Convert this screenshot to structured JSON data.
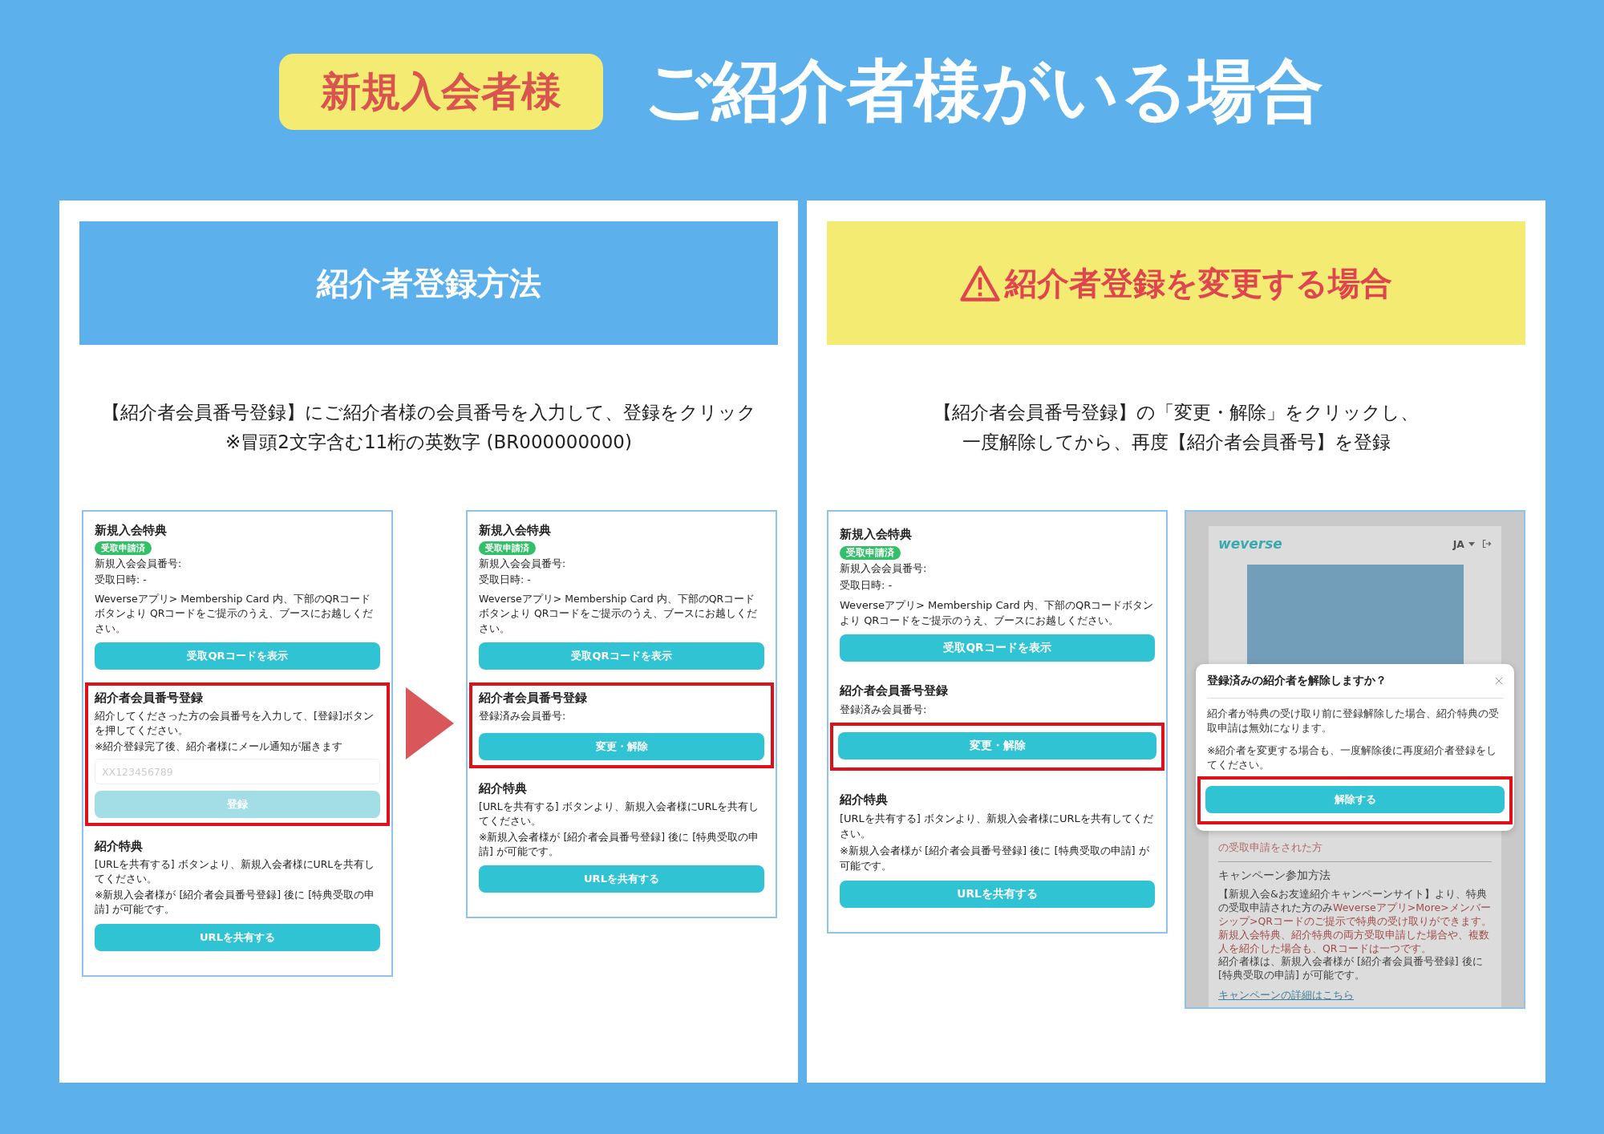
{
  "header": {
    "badge": "新規入会者様",
    "title": "ご紹介者様がいる場合"
  },
  "panels": [
    {
      "kind": "method",
      "heading": "紹介者登録方法",
      "arrow": true,
      "description": [
        "【紹介者会員番号登録】にご紹介者様の会員番号を入力して、登録をクリック",
        "※冒頭2文字含む11桁の英数字 (BR000000000)"
      ],
      "screens": [
        {
          "kind": "form",
          "benefit": {
            "title": "新規入会特典",
            "badge": "受取申請済",
            "member_no": "新規入会会員番号:",
            "date": "受取日時: -",
            "note": "Weverseアプリ> Membership Card 内、下部のQRコードボタンより QRコードをご提示のうえ、ブースにお越しください。",
            "button": "受取QRコードを表示"
          },
          "referral": {
            "title": "紹介者会員番号登録",
            "highlight": true,
            "text": "紹介してくださった方の会員番号を入力して、[登録]ボタンを押してください。",
            "note": "※紹介登録完了後、紹介者様にメール通知が届きます",
            "placeholder": "XX123456789",
            "button": "登録",
            "button_disabled": true,
            "button_highlight": false
          },
          "reward": {
            "title": "紹介特典",
            "text": "[URLを共有する] ボタンより、新規入会者様にURLを共有してください。",
            "note": "※新規入会者様が [紹介者会員番号登録] 後に [特典受取の申請] が可能です。",
            "button": "URLを共有する"
          }
        },
        {
          "kind": "form",
          "benefit": {
            "title": "新規入会特典",
            "badge": "受取申請済",
            "member_no": "新規入会会員番号:",
            "date": "受取日時: -",
            "note": "Weverseアプリ> Membership Card 内、下部のQRコードボタンより QRコードをご提示のうえ、ブースにお越しください。",
            "button": "受取QRコードを表示"
          },
          "referral": {
            "title": "紹介者会員番号登録",
            "highlight": true,
            "registered": "登録済み会員番号:",
            "button": "変更・解除",
            "button_disabled": false,
            "button_highlight": false
          },
          "reward": {
            "title": "紹介特典",
            "text": "[URLを共有する] ボタンより、新規入会者様にURLを共有してください。",
            "note": "※新規入会者様が [紹介者会員番号登録] 後に [特典受取の申請] が可能です。",
            "button": "URLを共有する"
          }
        }
      ]
    },
    {
      "kind": "warning",
      "heading": "紹介者登録を変更する場合",
      "arrow": false,
      "description": [
        "【紹介者会員番号登録】の「変更・解除」をクリックし、",
        "一度解除してから、再度【紹介者会員番号】を登録"
      ],
      "screens": [
        {
          "kind": "form",
          "benefit": {
            "title": "新規入会特典",
            "badge": "受取申請済",
            "member_no": "新規入会会員番号:",
            "date": "受取日時: -",
            "note": "Weverseアプリ> Membership Card 内、下部のQRコードボタンより QRコードをご提示のうえ、ブースにお越しください。",
            "button": "受取QRコードを表示"
          },
          "referral": {
            "title": "紹介者会員番号登録",
            "highlight": false,
            "registered": "登録済み会員番号:",
            "button": "変更・解除",
            "button_disabled": false,
            "button_highlight": true
          },
          "reward": {
            "title": "紹介特典",
            "text": "[URLを共有する] ボタンより、新規入会者様にURLを共有してください。",
            "note": "※新規入会者様が [紹介者会員番号登録] 後に [特典受取の申請] が可能です。",
            "button": "URLを共有する"
          }
        },
        {
          "kind": "modal",
          "logo": "weverse",
          "language": "JA",
          "partial_text": "の受取申請をされた方",
          "section_title": "キャンペーン参加方法",
          "paragraph": [
            {
              "text": "【新規入会&お友達紹介キャンペーンサイト】より、特典の受取申請された方のみ",
              "highlight": false,
              "new_line": false
            },
            {
              "text": "Weverseアプリ>More>メンバーシップ>QRコードのご提示で特典の受け取りができます。",
              "highlight": true,
              "new_line": false
            },
            {
              "text": "新規入会特典、紹介特典の両方受取申請した場合や、複数人を紹介した場合も、QRコードは一つです。",
              "highlight": true,
              "new_line": true
            },
            {
              "text": "紹介者様は、新規入会者様が [紹介者会員番号登録] 後に [特典受取の申請] が可能です。",
              "highlight": false,
              "new_line": true
            }
          ],
          "link": "キャンペーンの詳細はこちら",
          "dialog": {
            "title": "登録済みの紹介者を解除しますか？",
            "body": "紹介者が特典の受け取り前に登録解除した場合、紹介特典の受取申請は無効になります。",
            "note": "※紹介者を変更する場合も、一度解除後に再度紹介者登録をしてください。",
            "button": "解除する",
            "button_highlight": true
          }
        }
      ]
    }
  ]
}
